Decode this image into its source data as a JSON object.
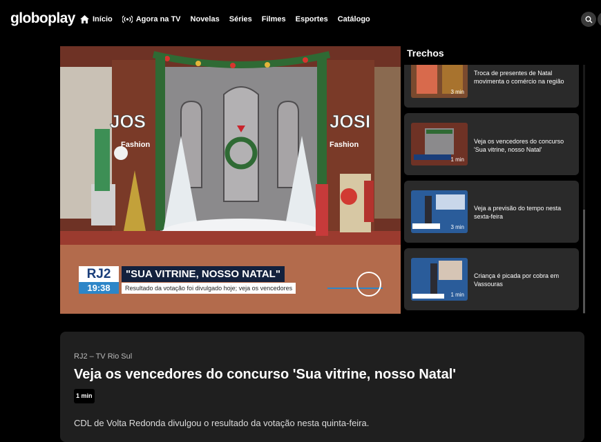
{
  "brand": {
    "logo": "globoplay"
  },
  "nav": {
    "items": [
      {
        "label": "Início",
        "icon": "home-icon"
      },
      {
        "label": "Agora na TV",
        "icon": "live-broadcast-icon"
      },
      {
        "label": "Novelas"
      },
      {
        "label": "Séries"
      },
      {
        "label": "Filmes"
      },
      {
        "label": "Esportes"
      },
      {
        "label": "Catálogo"
      }
    ],
    "search_icon": "search-icon"
  },
  "player": {
    "store_name_left": "JOSI Fashion",
    "store_name_right": "JOSI Fashion",
    "lower_third": {
      "show": "RJ2",
      "time": "19:38",
      "headline": "\"SUA VITRINE, NOSSO NATAL\"",
      "subtitle": "Resultado da votação foi divulgado hoje; veja os vencedores"
    }
  },
  "sidebar": {
    "title": "Trechos",
    "items": [
      {
        "title": "Troca de presentes de Natal movimenta o comércio na região",
        "duration": "3 min"
      },
      {
        "title": "Veja os vencedores do concurso 'Sua vitrine, nosso Natal'",
        "duration": "1 min"
      },
      {
        "title": "Veja a previsão do tempo nesta sexta-feira",
        "duration": "3 min"
      },
      {
        "title": "Criança é picada por cobra em Vassouras",
        "duration": "1 min"
      }
    ]
  },
  "info": {
    "program": "RJ2 – TV Rio Sul",
    "title": "Veja os vencedores do concurso 'Sua vitrine, nosso Natal'",
    "duration": "1 min",
    "description": "CDL de Volta Redonda divulgou o resultado da votação nesta quinta-feira."
  },
  "colors": {
    "background": "#000000",
    "card": "#2a2a2a",
    "panel": "#1f1f1f",
    "rj_blue": "#1a3e7a",
    "rj_light_blue": "#2d86c8"
  }
}
